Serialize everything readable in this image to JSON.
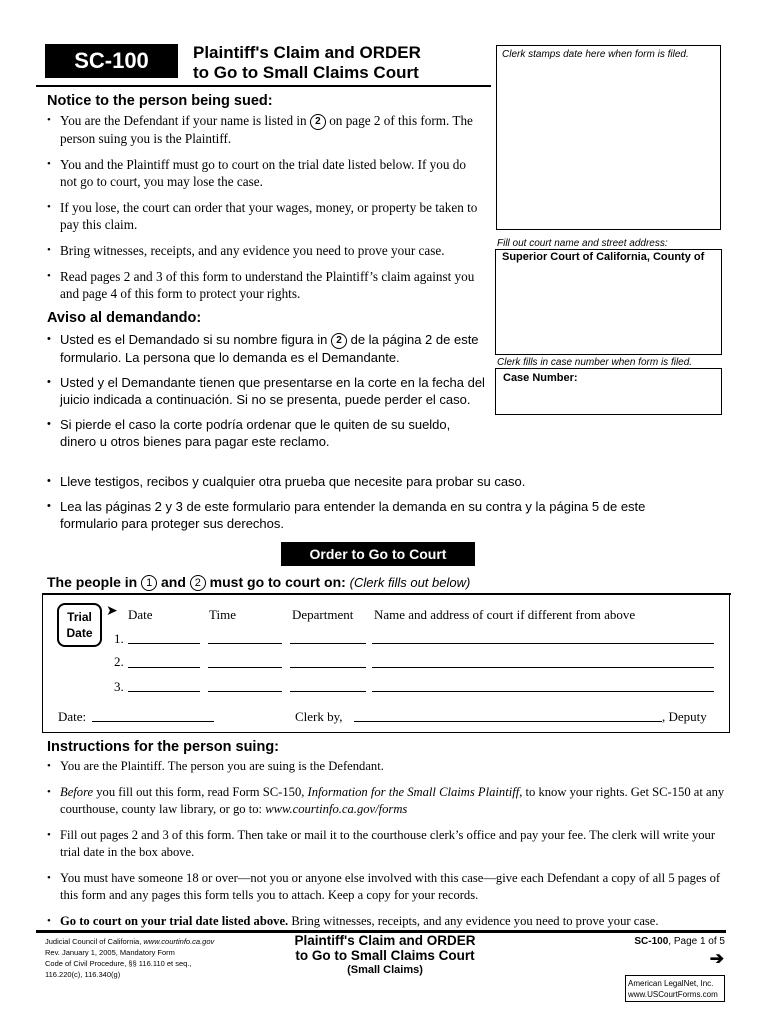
{
  "header": {
    "form_id": "SC-100",
    "title_line1": "Plaintiff's Claim and ORDER",
    "title_line2": "to Go to Small Claims Court"
  },
  "right_column": {
    "stamp_label": "Clerk stamps date here when form is filed.",
    "court_label": "Fill out court name and street address:",
    "court_value": "Superior Court of California, County of",
    "case_label": "Clerk fills in case number when form is filed.",
    "case_value": "Case Number:"
  },
  "notice": {
    "heading": "Notice to the person being sued:",
    "items": [
      {
        "pre": "You are the Defendant if your name is listed in ",
        "circle": "2",
        "post": " on page 2 of this form. The person suing you is the Plaintiff."
      },
      {
        "text": "You and the Plaintiff must go to court on the trial date listed below. If you do not go to court, you may lose the case."
      },
      {
        "text": "If you lose, the court can order that your wages, money, or property be taken to pay this claim."
      },
      {
        "text": "Bring witnesses, receipts, and any evidence you need to prove your case."
      },
      {
        "text": "Read pages 2 and 3 of this form to understand the Plaintiff’s claim against you and page 4 of this form to protect your rights."
      }
    ]
  },
  "aviso": {
    "heading": "Aviso al demandando:",
    "items": [
      {
        "pre": "Usted es el Demandado si su nombre figura in ",
        "circle": "2",
        "post": " de la página 2 de este formulario. La persona que lo demanda es el Demandante."
      },
      {
        "text": "Usted y el Demandante tienen que presentarse en la corte en la fecha del juicio indicada a continuación. Si no se presenta, puede perder el caso."
      },
      {
        "text": "Si pierde el caso la corte podría ordenar que le quiten de su sueldo, dinero u otros bienes para pagar este reclamo."
      },
      {
        "text": "Lleve testigos, recibos y cualquier otra prueba que necesite para probar su caso."
      },
      {
        "text": "Lea las páginas 2 y 3 de este formulario para entender la demanda en su contra y la página 5 de este formulario para proteger sus derechos."
      }
    ]
  },
  "order": {
    "banner": "Order to Go to Court",
    "people_pre": "The people in ",
    "circle1": "1",
    "people_mid": " and ",
    "circle2": "2",
    "people_post": " must go to court on: ",
    "people_note": "(Clerk fills out below)",
    "trial_badge_line1": "Trial",
    "trial_badge_line2": "Date",
    "columns": [
      "Date",
      "Time",
      "Department",
      "Name and address of court if different from above"
    ],
    "rows": [
      "1.",
      "2.",
      "3."
    ],
    "date_label": "Date:",
    "clerk_label": "Clerk by,",
    "deputy_label": ", Deputy"
  },
  "instructions": {
    "heading": "Instructions for the person suing:",
    "item1": "You are the Plaintiff. The person you are suing is the Defendant.",
    "item2_italic1": "Before",
    "item2_text1": " you fill out this form, read Form SC-150, ",
    "item2_italic2": "Information for the Small Claims Plaintiff,",
    "item2_text2": " to know your rights. Get SC-150 at any courthouse, county law library, or go to: ",
    "item2_link": "www.courtinfo.ca.gov/forms",
    "item3": "Fill out pages 2 and 3 of this form. Then take or mail it to the courthouse clerk’s office and pay your fee. The clerk will write your trial date in the box above.",
    "item4": "You must have someone 18 or over—not you or anyone else involved with this case—give each Defendant a copy of all 5 pages of this form and any pages this form tells you to attach. Keep a copy for your records.",
    "item5_bold": "Go to court on your trial date listed above.",
    "item5_text": " Bring witnesses, receipts, and any evidence you need to prove your case."
  },
  "footer": {
    "left_line1_pre": "Judicial Council of California, ",
    "left_line1_link": "www.courtinfo.ca.gov",
    "left_line2": "Rev. January 1, 2005, Mandatory Form",
    "left_line3": "Code of Civil Procedure, §§ 116.110 et seq.,",
    "left_line4": "116.220(c), 116.340(g)",
    "title_line1": "Plaintiff's Claim and ORDER",
    "title_line2": "to Go to Small Claims Court",
    "title_line3": "(Small Claims)",
    "page_form": "SC-100",
    "page_text": ", Page 1 of 5",
    "next_arrow": "➔",
    "legalnet_line1": "American LegalNet, Inc.",
    "legalnet_line2": "www.USCourtForms.com"
  }
}
